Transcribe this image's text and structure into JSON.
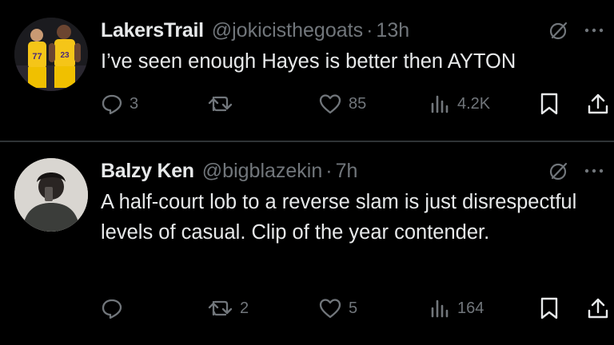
{
  "tweets": [
    {
      "display_name": "LakersTrail",
      "handle": "@jokicisthegoats",
      "separator": "·",
      "time": "13h",
      "text": "I’ve seen enough Hayes is better then AYTON",
      "avatar_jerseys": [
        "77",
        "23"
      ],
      "counts": {
        "replies": "3",
        "retweets": "",
        "likes": "85",
        "views": "4.2K"
      }
    },
    {
      "display_name": "Balzy Ken",
      "handle": "@bigblazekin",
      "separator": "·",
      "time": "7h",
      "text": "A half-court lob to a reverse slam is just disrespectful levels of casual. Clip of the year contender.",
      "counts": {
        "replies": "",
        "retweets": "2",
        "likes": "5",
        "views": "164"
      }
    }
  ],
  "icons": {
    "reply": "reply-icon",
    "retweet": "retweet-icon",
    "like": "like-icon",
    "views": "views-icon",
    "bookmark": "bookmark-icon",
    "share": "share-icon",
    "grok": "grok-icon",
    "more": "more-icon"
  },
  "colors": {
    "background": "#000000",
    "text": "#e7e9ea",
    "muted": "#71767b",
    "divider": "#2f3336",
    "jersey": "#f5c518"
  }
}
